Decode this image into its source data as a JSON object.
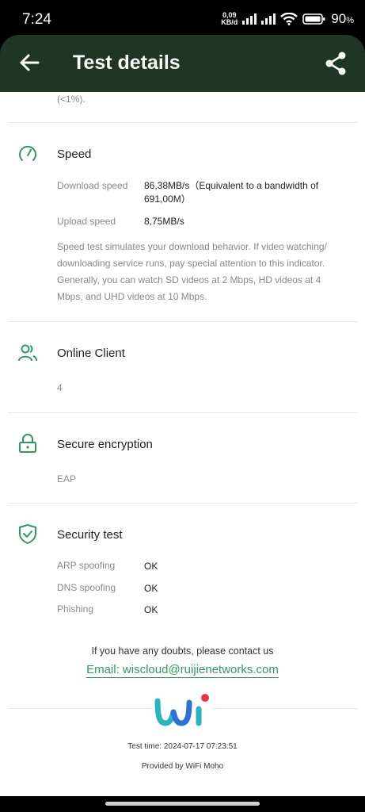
{
  "status_bar": {
    "time": "7:24",
    "net_speed_value": "0,09",
    "net_speed_unit": "KB/d",
    "battery": "90"
  },
  "header": {
    "title": "Test details",
    "back_icon": "arrow-left-icon",
    "share_icon": "share-icon"
  },
  "content": {
    "continued_text": "(<1%).",
    "speed": {
      "title": "Speed",
      "icon": "speedometer-icon",
      "download_label": "Download speed",
      "download_value": "86,38MB/s（Equivalent to a bandwidth of 691,00M）",
      "upload_label": "Upload speed",
      "upload_value": "8,75MB/s",
      "description": "Speed test simulates your download behavior. If video watching/ downloading service runs, pay special attention to this indicator. Generally, you can watch SD videos at 2 Mbps, HD videos at 4 Mbps, and UHD videos at 10 Mbps."
    },
    "online_client": {
      "title": "Online Client",
      "icon": "users-icon",
      "value": "4"
    },
    "secure_encryption": {
      "title": "Secure encryption",
      "icon": "lock-icon",
      "value": "EAP"
    },
    "security_test": {
      "title": "Security test",
      "icon": "shield-check-icon",
      "rows": [
        {
          "label": "ARP spoofing",
          "value": "OK"
        },
        {
          "label": "DNS spoofing",
          "value": "OK"
        },
        {
          "label": "Phishing",
          "value": "OK"
        }
      ]
    },
    "contact": {
      "note": "If you have any doubts, please contact us",
      "email": "Email: wiscloud@ruijienetworks.com"
    },
    "footer": {
      "test_time": "Test time: 2024-07-17 07:23:51",
      "provided_by": "Provided by WiFi Moho"
    }
  },
  "colors": {
    "header_bg": "#1f3526",
    "accent_green": "#2e9a5a",
    "logo_teal": "#2bb3c0",
    "logo_blue": "#2f6fd6",
    "logo_red": "#e63946"
  }
}
